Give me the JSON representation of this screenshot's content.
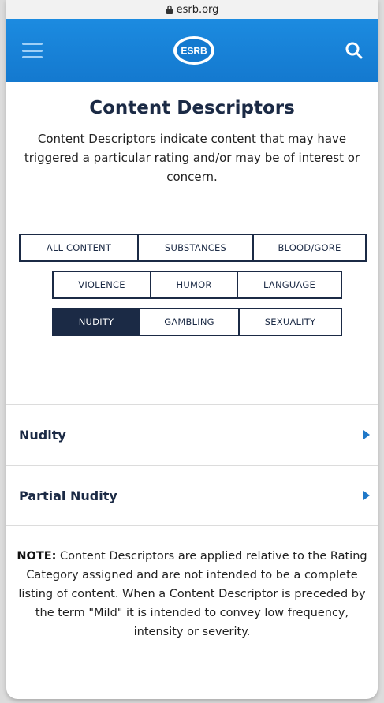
{
  "browser": {
    "url": "esrb.org"
  },
  "header": {
    "logo_text": "ESRB"
  },
  "page": {
    "title": "Content Descriptors",
    "intro": "Content Descriptors indicate content that may have triggered a particular rating and/or may be of interest or concern."
  },
  "filters": [
    {
      "label": "ALL CONTENT",
      "active": false
    },
    {
      "label": "SUBSTANCES",
      "active": false
    },
    {
      "label": "BLOOD/GORE",
      "active": false
    },
    {
      "label": "VIOLENCE",
      "active": false
    },
    {
      "label": "HUMOR",
      "active": false
    },
    {
      "label": "LANGUAGE",
      "active": false
    },
    {
      "label": "NUDITY",
      "active": true
    },
    {
      "label": "GAMBLING",
      "active": false
    },
    {
      "label": "SEXUALITY",
      "active": false
    }
  ],
  "descriptors": [
    {
      "label": "Nudity"
    },
    {
      "label": "Partial Nudity"
    }
  ],
  "note": {
    "prefix": "NOTE:",
    "text": " Content Descriptors are applied relative to the Rating Category assigned and are not intended to be a complete listing of content. When a Content Descriptor is preceded by the term \"Mild\" it is intended to convey low frequency, intensity or severity."
  },
  "colors": {
    "brand": "#1479cf",
    "navy": "#1b2a45",
    "accent_arrow": "#1f78c8"
  }
}
